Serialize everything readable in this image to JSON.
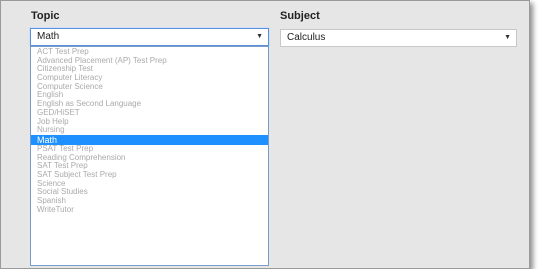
{
  "topic": {
    "label": "Topic",
    "selected_value": "Math",
    "options": [
      "ACT Test Prep",
      "Advanced Placement (AP) Test Prep",
      "Citizenship Test",
      "Computer Literacy",
      "Computer Science",
      "English",
      "English as Second Language",
      "GED/HiSET",
      "Job Help",
      "Nursing",
      "Math",
      "PSAT Test Prep",
      "Reading Comprehension",
      "SAT Test Prep",
      "SAT Subject Test Prep",
      "Science",
      "Social Studies",
      "Spanish",
      "WriteTutor"
    ],
    "highlighted_index": 10
  },
  "subject": {
    "label": "Subject",
    "selected_value": "Calculus"
  },
  "colors": {
    "highlight": "#1e90ff",
    "panel_bg": "#e6e6e6"
  }
}
